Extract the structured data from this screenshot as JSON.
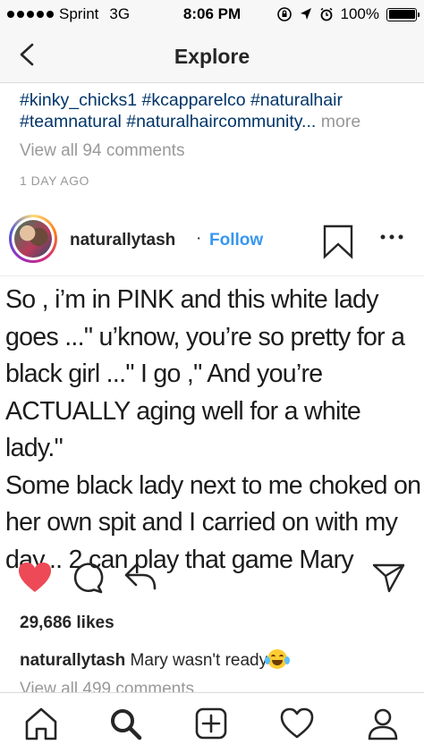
{
  "status": {
    "carrier": "Sprint",
    "network": "3G",
    "time": "8:06 PM",
    "battery": "100%"
  },
  "nav": {
    "title": "Explore"
  },
  "prev_post": {
    "hashtags_line1": "#kinky_chicks1 #kcapparelco #naturalhair",
    "hashtags_line2": "#teamnatural #naturalhaircommunity...",
    "more": " more",
    "view_comments": "View all 94 comments",
    "time_ago": "1 DAY AGO"
  },
  "post": {
    "username": "naturallytash",
    "separator": "·",
    "follow": "Follow",
    "text": "So , i’m in PINK and this white lady\ngoes ...\" u’know, you’re so pretty for a\nblack girl ...\" I go ,\" And you’re\nACTUALLY aging well for a white lady.\"\nSome black lady next to me choked on\nher own spit and I carried on with my\nday... 2 can play that game Mary",
    "likes": "29,686 likes",
    "caption_user": "naturallytash",
    "caption_text": " Mary wasn't ready",
    "view_comments": "View all 499 comments"
  },
  "icons": {
    "like": "heart-icon",
    "comment": "comment-icon",
    "share": "share-icon",
    "direct": "direct-icon",
    "home": "home-icon",
    "search": "search-icon",
    "add": "add-icon",
    "activity": "activity-icon",
    "profile": "profile-icon"
  },
  "colors": {
    "link": "#003569",
    "follow": "#3897f0",
    "like": "#ed4956",
    "muted": "#999999"
  }
}
